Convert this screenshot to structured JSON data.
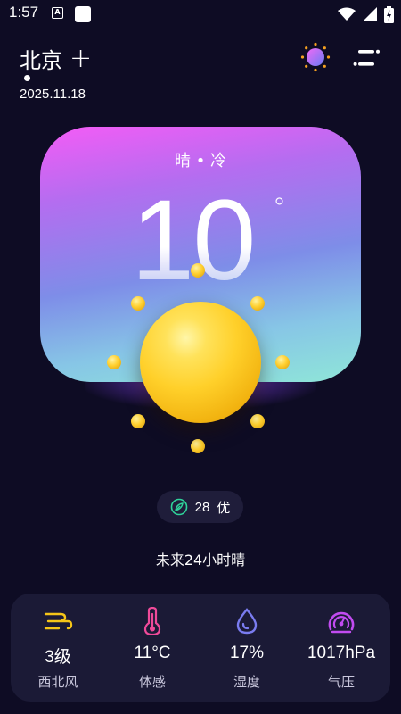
{
  "status_bar": {
    "time": "1:57",
    "notification_icon": "a-badge-icon",
    "icons": [
      "wifi-icon",
      "signal-icon",
      "battery-charging-icon"
    ]
  },
  "header": {
    "city": "北京",
    "add_icon": "+",
    "date": "2025.11.18",
    "theme_icon": "sun-theme-icon",
    "menu_icon": "menu-icon"
  },
  "weather": {
    "condition": "晴 • 冷",
    "temperature": "10",
    "degree_symbol": "°",
    "air_quality": {
      "value": "28",
      "level": "优"
    },
    "forecast": "未来24小时晴"
  },
  "details": [
    {
      "icon": "wind-icon",
      "value": "3级",
      "label": "西北风",
      "color": "#f5c518"
    },
    {
      "icon": "thermometer-icon",
      "value": "11°C",
      "label": "体感",
      "color": "#f04a9a"
    },
    {
      "icon": "humidity-drop-icon",
      "value": "17%",
      "label": "湿度",
      "color": "#7a7cf0"
    },
    {
      "icon": "pressure-gauge-icon",
      "value": "1017hPa",
      "label": "气压",
      "color": "#c14bf0"
    }
  ],
  "colors": {
    "background": "#0e0c24",
    "card_gradient": [
      "#f45cf6",
      "#7e8de8",
      "#8fe6d8"
    ],
    "panel": "#1b1a36",
    "aqi_leaf": "#2fd39a"
  }
}
